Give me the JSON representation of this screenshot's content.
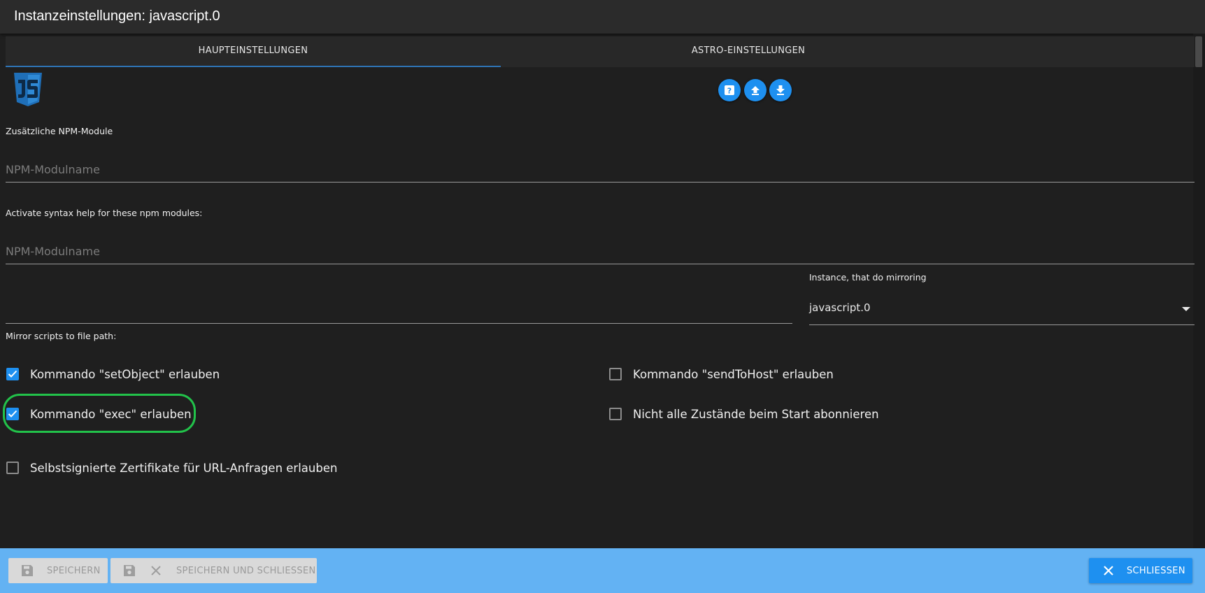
{
  "dialog": {
    "title": "Instanzeinstellungen: javascript.0"
  },
  "tabs": [
    {
      "label": "HAUPTEINSTELLUNGEN",
      "active": true
    },
    {
      "label": "ASTRO-EINSTELLUNGEN",
      "active": false
    }
  ],
  "logo": {
    "icon": "javascript-logo"
  },
  "toolbar": {
    "help_icon": "help-icon",
    "upload_icon": "upload-icon",
    "download_icon": "download-icon"
  },
  "npm_modules": {
    "label": "Zusätzliche NPM-Module",
    "placeholder": "NPM-Modulname",
    "value": ""
  },
  "syntax_help": {
    "label": "Activate syntax help for these npm modules:",
    "placeholder": "NPM-Modulname",
    "value": ""
  },
  "mirror": {
    "path_label": "Mirror scripts to file path:",
    "path_value": "",
    "instance_label": "Instance, that do mirroring",
    "instance_value": "javascript.0"
  },
  "options": [
    {
      "label": "Kommando \"setObject\" erlauben",
      "checked": true
    },
    {
      "label": "Kommando \"sendToHost\" erlauben",
      "checked": false
    },
    {
      "label": "Kommando \"exec\" erlauben",
      "checked": true
    },
    {
      "label": "Nicht alle Zustände beim Start abonnieren",
      "checked": false
    },
    {
      "label": "Selbstsignierte Zertifikate für URL-Anfragen erlauben",
      "checked": false
    }
  ],
  "footer": {
    "save_label": "SPEICHERN",
    "save_close_label": "SPEICHERN UND SCHLIESSEN",
    "close_label": "SCHLIESSEN"
  },
  "colors": {
    "accent": "#1e90f0",
    "footer_bar": "#63b2f3",
    "highlight": "#22c24a",
    "background": "#1f1f1f"
  }
}
